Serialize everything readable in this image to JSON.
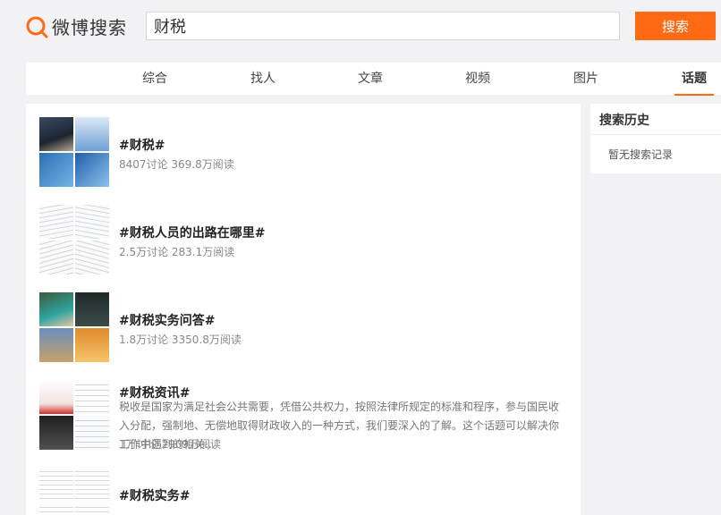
{
  "header": {
    "logo_text": "微博搜索",
    "search_value": "财税",
    "search_button_label": "搜索"
  },
  "tabs": [
    {
      "label": "综合",
      "active": false
    },
    {
      "label": "找人",
      "active": false
    },
    {
      "label": "文章",
      "active": false
    },
    {
      "label": "视频",
      "active": false
    },
    {
      "label": "图片",
      "active": false
    },
    {
      "label": "话题",
      "active": true
    }
  ],
  "topics": [
    {
      "title": "#财税#",
      "meta": "8407讨论 369.8万阅读",
      "description": ""
    },
    {
      "title": "#财税人员的出路在哪里#",
      "meta": "2.5万讨论 283.1万阅读",
      "description": ""
    },
    {
      "title": "#财税实务问答#",
      "meta": "1.8万讨论 3350.8万阅读",
      "description": ""
    },
    {
      "title": "#财税资讯#",
      "meta": "1万讨论 2909万阅读",
      "description": "税收是国家为满足社会公共需要，凭借公共权力，按照法律所规定的标准和程序，参与国民收入分配，强制地、无偿地取得财政收入的一种方式，我们要深入的了解。这个话题可以解决你工作中遇到的相关..."
    },
    {
      "title": "#财税实务#",
      "meta": "",
      "description": ""
    }
  ],
  "sidebar": {
    "title": "搜索历史",
    "empty_text": "暂无搜索记录"
  },
  "colors": {
    "accent": "#ff6a13",
    "background": "#f2f2f5"
  }
}
